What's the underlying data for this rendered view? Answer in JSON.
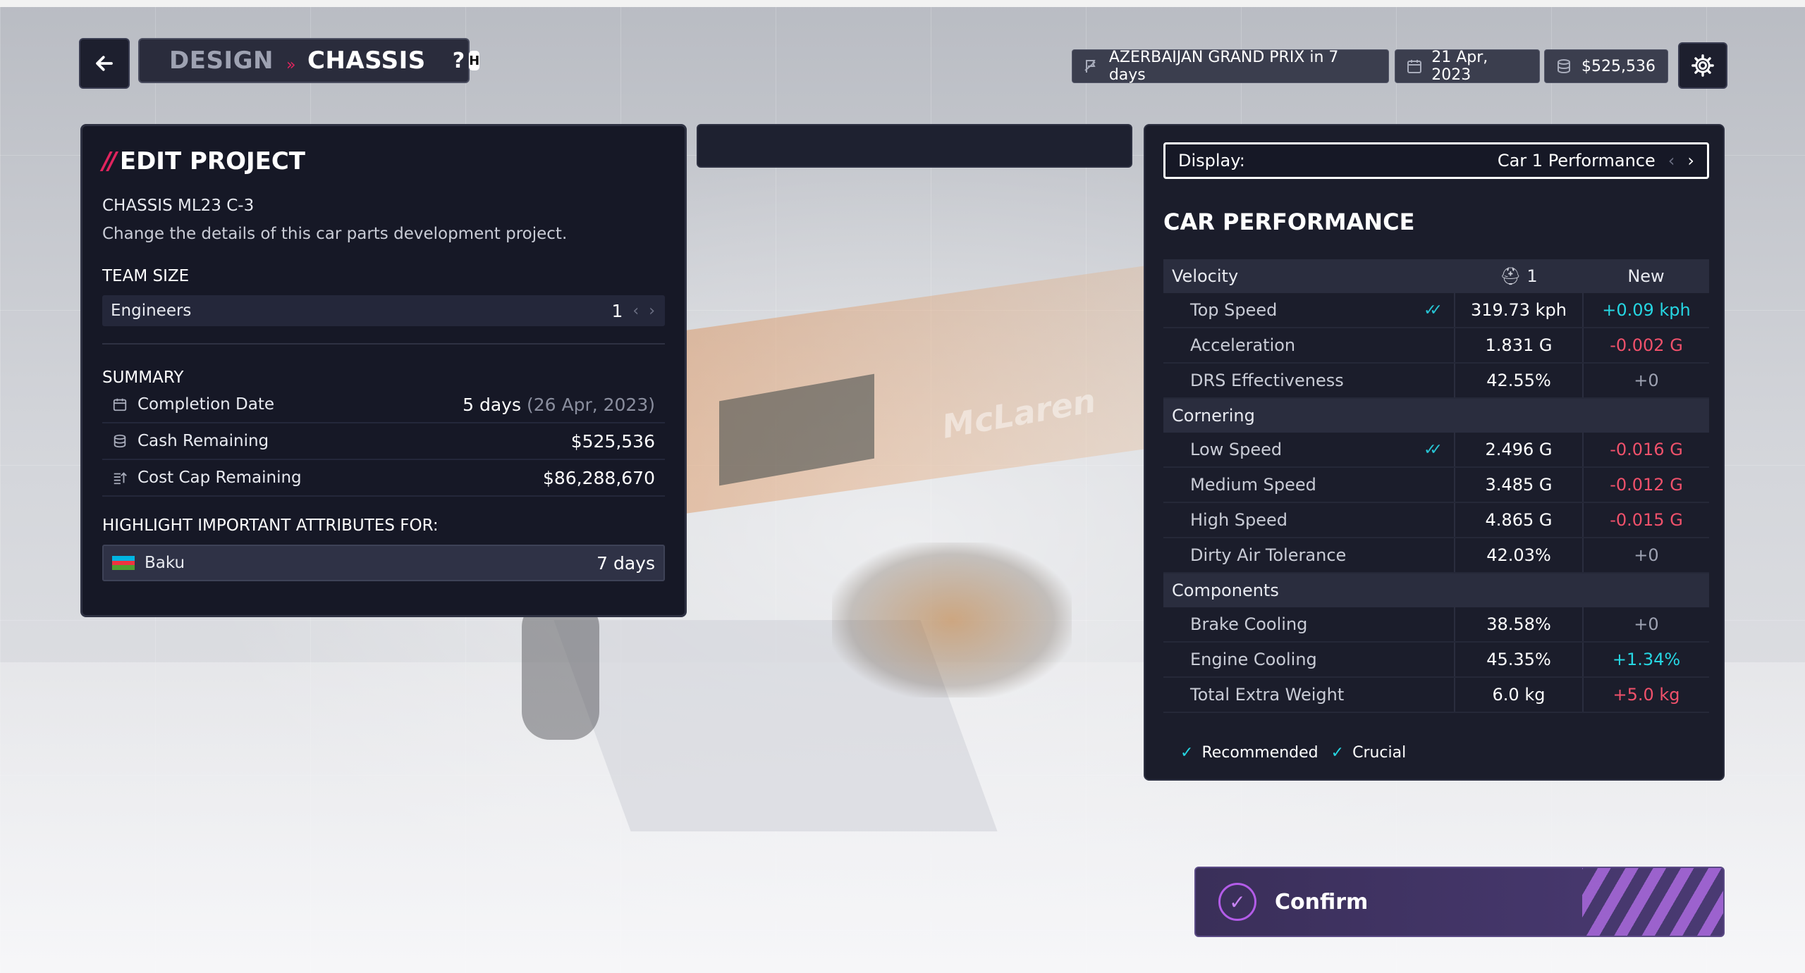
{
  "header": {
    "crumb_section": "DESIGN",
    "crumb_page": "CHASSIS",
    "help_label": "?",
    "help_key": "H",
    "event": "AZERBAIJAN GRAND PRIX in 7 days",
    "date": "21 Apr, 2023",
    "cash": "$525,536"
  },
  "edit_project": {
    "title": "EDIT PROJECT",
    "project_name": "CHASSIS ML23 C-3",
    "description": "Change the details of this car parts development project.",
    "team_size_heading": "TEAM SIZE",
    "engineers_label": "Engineers",
    "engineers_value": "1",
    "summary_heading": "SUMMARY",
    "completion_label": "Completion Date",
    "completion_days": "5 days",
    "completion_date": "(26 Apr, 2023)",
    "cash_label": "Cash Remaining",
    "cash_value": "$525,536",
    "costcap_label": "Cost Cap Remaining",
    "costcap_value": "$86,288,670",
    "highlight_heading": "HIGHLIGHT IMPORTANT ATTRIBUTES FOR:",
    "highlight_track": "Baku",
    "highlight_days": "7 days"
  },
  "performance": {
    "display_label": "Display:",
    "display_value": "Car 1 Performance",
    "title": "CAR PERFORMANCE",
    "car_col": "1",
    "new_col": "New",
    "categories": [
      {
        "name": "Velocity",
        "rows": [
          {
            "name": "Top Speed",
            "value": "319.73 kph",
            "change": "+0.09 kph",
            "sign": "pos",
            "check": true
          },
          {
            "name": "Acceleration",
            "value": "1.831 G",
            "change": "-0.002 G",
            "sign": "neg",
            "check": false
          },
          {
            "name": "DRS Effectiveness",
            "value": "42.55%",
            "change": "+0",
            "sign": "zero",
            "check": false
          }
        ]
      },
      {
        "name": "Cornering",
        "rows": [
          {
            "name": "Low Speed",
            "value": "2.496 G",
            "change": "-0.016 G",
            "sign": "neg",
            "check": true
          },
          {
            "name": "Medium Speed",
            "value": "3.485 G",
            "change": "-0.012 G",
            "sign": "neg",
            "check": false
          },
          {
            "name": "High Speed",
            "value": "4.865 G",
            "change": "-0.015 G",
            "sign": "neg",
            "check": false
          },
          {
            "name": "Dirty Air Tolerance",
            "value": "42.03%",
            "change": "+0",
            "sign": "zero",
            "check": false
          }
        ]
      },
      {
        "name": "Components",
        "rows": [
          {
            "name": "Brake Cooling",
            "value": "38.58%",
            "change": "+0",
            "sign": "zero",
            "check": false
          },
          {
            "name": "Engine Cooling",
            "value": "45.35%",
            "change": "+1.34%",
            "sign": "pos",
            "check": false
          },
          {
            "name": "Total Extra Weight",
            "value": "6.0 kg",
            "change": "+5.0 kg",
            "sign": "neg",
            "check": false
          }
        ]
      }
    ],
    "legend_recommended": "Recommended",
    "legend_crucial": "Crucial"
  },
  "confirm_label": "Confirm",
  "background_logo": "McLaren",
  "colors": {
    "accent": "#e0245e",
    "positive": "#26d6e2",
    "negative": "#f0516b",
    "confirm": "#4a3a73"
  }
}
